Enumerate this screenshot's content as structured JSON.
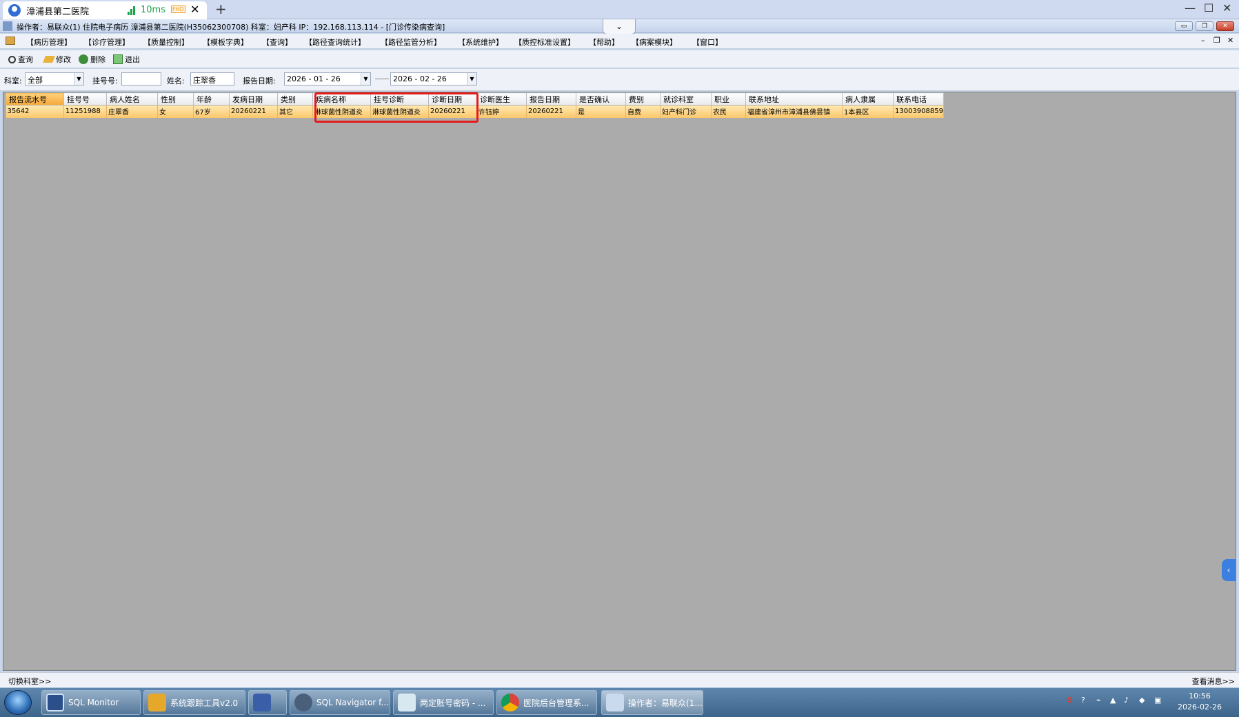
{
  "remote_tab": {
    "title": "漳浦县第二医院",
    "latency": "10ms",
    "quality": "FHD"
  },
  "app": {
    "title": "操作者：易联众(1) 住院电子病历  漳浦县第二医院(H35062300708)  科室：妇产科  IP：192.168.113.114 - [门诊传染病查询]"
  },
  "menu": [
    "【病历管理】",
    "【诊疗管理】",
    "【质量控制】",
    "【模板字典】",
    "【查询】",
    "【路径查询统计】",
    "【路径监管分析】",
    "【系统维护】",
    "【质控标准设置】",
    "【帮助】",
    "【病案模块】",
    "【窗口】"
  ],
  "toolbar": {
    "query": "查询",
    "edit": "修改",
    "delete": "删除",
    "exit": "退出"
  },
  "filter": {
    "dept_label": "科室:",
    "dept_value": "全部",
    "reg_label": "挂号号:",
    "reg_value": "",
    "name_label": "姓名:",
    "name_value": "庄翠香",
    "date_label": "报告日期:",
    "date_from": "2026 - 01 - 26",
    "date_to": "2026 - 02 - 26"
  },
  "grid": {
    "columns": [
      "报告流水号",
      "挂号号",
      "病人姓名",
      "性别",
      "年龄",
      "发病日期",
      "类别",
      "疾病名称",
      "挂号诊断",
      "诊断日期",
      "诊断医生",
      "报告日期",
      "是否确认",
      "费别",
      "就诊科室",
      "职业",
      "联系地址",
      "病人隶属",
      "联系电话"
    ],
    "rows": [
      [
        "35642",
        "11251988",
        "庄翠香",
        "女",
        "67岁",
        "20260221",
        "其它",
        "淋球菌性阴道炎",
        "淋球菌性阴道炎",
        "20260221",
        "许钰婷",
        "20260221",
        "是",
        "自费",
        "妇产科门诊",
        "农民",
        "福建省漳州市漳浦县佛昙镇",
        "1本县区",
        "13003908859"
      ]
    ]
  },
  "status": {
    "left": "切换科室>>",
    "right": "查看消息>>"
  },
  "taskbar": {
    "items": [
      "SQL Monitor",
      "系统跟踪工具v2.0",
      "",
      "SQL Navigator f...",
      "两定账号密码 - ...",
      "医院后台管理系...",
      "操作者：易联众(1..."
    ],
    "time": "10:56",
    "date": "2026-02-26"
  }
}
